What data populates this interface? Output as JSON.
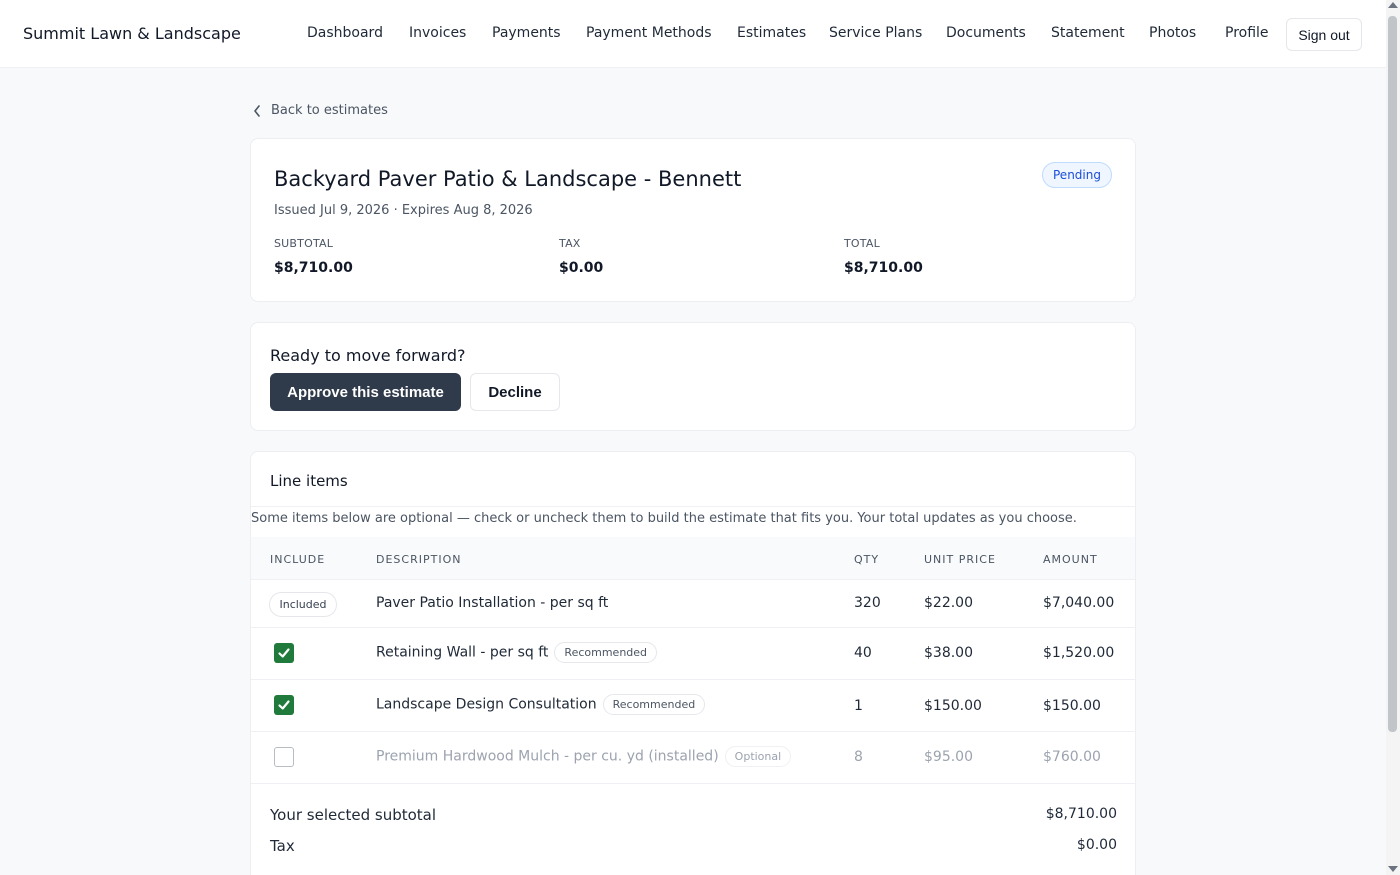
{
  "header": {
    "brand": "Summit Lawn & Landscape",
    "nav": [
      "Dashboard",
      "Invoices",
      "Payments",
      "Payment Methods",
      "Estimates",
      "Service Plans",
      "Documents",
      "Statement",
      "Photos",
      "Profile"
    ],
    "sign_out": "Sign out"
  },
  "back_link": "Back to estimates",
  "estimate": {
    "title": "Backyard Paver Patio & Landscape - Bennett",
    "dates": "Issued Jul 9, 2026 · Expires Aug 8, 2026",
    "status": "Pending",
    "summary": {
      "subtotal_label": "SUBTOTAL",
      "subtotal": "$8,710.00",
      "tax_label": "TAX",
      "tax": "$0.00",
      "total_label": "TOTAL",
      "total": "$8,710.00"
    }
  },
  "action": {
    "heading": "Ready to move forward?",
    "approve": "Approve this estimate",
    "decline": "Decline"
  },
  "line_items": {
    "title": "Line items",
    "note": "Some items below are optional — check or uncheck them to build the estimate that fits you. Your total updates as you choose.",
    "columns": [
      "INCLUDE",
      "DESCRIPTION",
      "QTY",
      "UNIT PRICE",
      "AMOUNT"
    ],
    "rows": [
      {
        "include": "Included",
        "description": "Paver Patio Installation - per sq ft",
        "tag": "",
        "qty": "320",
        "unit_price": "$22.00",
        "amount": "$7,040.00"
      },
      {
        "include": "checked",
        "description": "Retaining Wall - per sq ft",
        "tag": "Recommended",
        "qty": "40",
        "unit_price": "$38.00",
        "amount": "$1,520.00"
      },
      {
        "include": "checked",
        "description": "Landscape Design Consultation",
        "tag": "Recommended",
        "qty": "1",
        "unit_price": "$150.00",
        "amount": "$150.00"
      },
      {
        "include": "unchecked",
        "description": "Premium Hardwood Mulch - per cu. yd (installed)",
        "tag": "Optional",
        "qty": "8",
        "unit_price": "$95.00",
        "amount": "$760.00"
      }
    ],
    "selected_subtotal_label": "Your selected subtotal",
    "selected_subtotal": "$8,710.00",
    "tax_label": "Tax",
    "tax": "$0.00"
  }
}
